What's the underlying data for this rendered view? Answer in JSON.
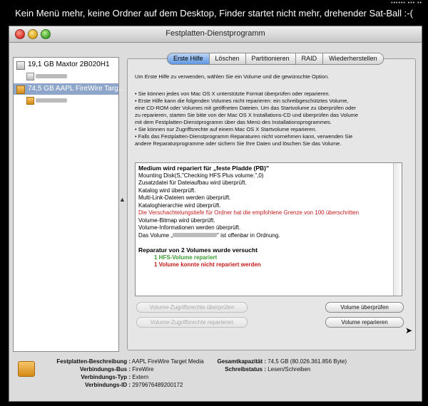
{
  "menubar": {
    "caption": "Kein Menü mehr, keine Ordner auf dem Desktop, Finder startet nicht mehr, drehender Sat-Ball :-(",
    "tray": "•••••• ••• ••"
  },
  "window": {
    "title": "Festplatten-Dienstprogramm"
  },
  "sidebar": {
    "disks": [
      {
        "label": "19,1 GB Maxtor 2B020H1",
        "icon": "hard-disk-icon"
      },
      {
        "label": "74,5 GB AAPL FireWire Targ...",
        "icon": "firewire-disk-icon"
      }
    ]
  },
  "tabs": [
    "Erste Hilfe",
    "Löschen",
    "Partitionieren",
    "RAID",
    "Wiederherstellen"
  ],
  "active_tab": "Erste Hilfe",
  "intro": "Um Erste Hilfe zu verwenden, wählen Sie ein Volume und die gewünschte Option.",
  "bullets": [
    "• Sie können jedes von Mac OS X unterstützte Format überprüfen oder reparieren.",
    "• Erste Hilfe kann die folgenden Volumes nicht reparieren: ein schreibgeschütztes Volume,",
    "eine CD-ROM oder Volumes mit geöffneten Dateien. Um das Startvolume zu überprüfen oder",
    "zu reparieren, starten Sie bitte von der Mac OS X Installations-CD und überprüfen das Volume",
    "mit dem Festplatten-Dienstprogramm über das Menü des Installationsprogrammes.",
    "• Sie können nur Zugriffsrechte auf einem Mac OS X Startvolume reparieren.",
    "• Falls das Festplatten-Dienstprogramm Reparaturen nicht vornehmen kann, verwenden Sie",
    "andere Reparaturprogramme oder sichern Sie Ihre Daten und löschen Sie das Volume."
  ],
  "log": {
    "heading": "Medium wird repariert für „feste Pladde (PB)\"",
    "lines": [
      "Mounting Disk(S,\"Checking HFS Plus volume.\",0)",
      "Zusatzdatei für Dateiaufbau wird überprüft.",
      "Katalog wird überprüft.",
      "Multi-Link-Dateien werden überprüft.",
      "Kataloghierarchie wird überprüft."
    ],
    "warning": "Die Verschachtelungstiefe für Ordner hat die empfohlene Grenze von 100 überschritten",
    "lines2": [
      "Volume-Bitmap wird überprüft.",
      "Volume-Informationen werden überprüft."
    ],
    "ok_prefix": "Das Volume „",
    "ok_suffix": "\" ist offenbar in Ordnung.",
    "summary": "Reparatur von 2 Volumes wurde versucht",
    "repaired": "1 HFS-Volume repariert",
    "failed": "1 Volume konnte nicht repariert werden"
  },
  "buttons": {
    "verify_permissions": "Volume-Zugriffsrechte überprüfen",
    "repair_permissions": "Volume-Zugriffsrechte reparieren",
    "verify_volume": "Volume überprüfen",
    "repair_volume": "Volume reparieren"
  },
  "info": {
    "beschreibung_k": "Festplatten-Beschreibung :",
    "beschreibung_v": "AAPL FireWire Target Media",
    "bus_k": "Verbindungs-Bus :",
    "bus_v": "FireWire",
    "typ_k": "Verbindungs-Typ :",
    "typ_v": "Extern",
    "id_k": "Verbindungs-ID :",
    "id_v": "2979676489200172",
    "kap_k": "Gesamtkapazität :",
    "kap_v": "74,5 GB (80.026.361.856 Byte)",
    "status_k": "Schreibstatus :",
    "status_v": "Lesen/Schreiben"
  }
}
